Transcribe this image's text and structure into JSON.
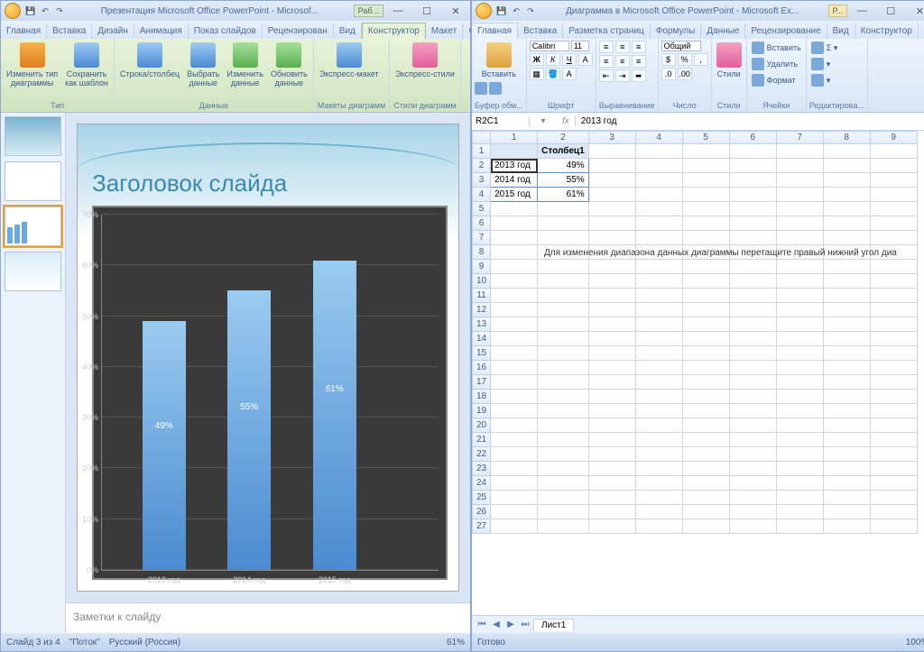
{
  "powerpoint": {
    "title": "Презентация Microsoft Office PowerPoint - Microsof...",
    "context_tab": "Раб...",
    "tabs": [
      "Главная",
      "Вставка",
      "Дизайн",
      "Анимация",
      "Показ слайдов",
      "Рецензирован",
      "Вид",
      "Конструктор",
      "Макет",
      "Формат"
    ],
    "active_tab_index": 7,
    "ribbon_groups": {
      "type": {
        "change_type": "Изменить тип\nдиаграммы",
        "save_template": "Сохранить\nкак шаблон",
        "label": "Тип"
      },
      "data": {
        "switch": "Строка/столбец",
        "select": "Выбрать\nданные",
        "edit": "Изменить\nданные",
        "refresh": "Обновить\nданные",
        "label": "Данные"
      },
      "layouts": {
        "express_layout": "Экспресс-макет",
        "label": "Макеты диаграмм"
      },
      "styles": {
        "express_styles": "Экспресс-стили",
        "label": "Стили диаграмм"
      }
    },
    "slide_title": "Заголовок слайда",
    "notes_placeholder": "Заметки к слайду",
    "status": {
      "slide": "Слайд 3 из 4",
      "theme": "\"Поток\"",
      "lang": "Русский (Россия)",
      "zoom": "61%"
    }
  },
  "excel": {
    "title": "Диаграмма в Microsoft Office PowerPoint - Microsoft Ex...",
    "context_tab": "Р...",
    "tabs": [
      "Главная",
      "Вставка",
      "Разметка страниц",
      "Формулы",
      "Данные",
      "Рецензирование",
      "Вид",
      "Конструктор"
    ],
    "ribbon": {
      "clipboard": {
        "paste": "Вставить",
        "label": "Буфер обм..."
      },
      "font": {
        "name": "Calibri",
        "size": "11",
        "label": "Шрифт"
      },
      "align": {
        "label": "Выравнивание"
      },
      "number": {
        "format": "Общий",
        "label": "Число"
      },
      "styles": {
        "btn": "Стили",
        "label": "Стили"
      },
      "cells": {
        "insert": "Вставить",
        "delete": "Удалить",
        "format": "Формат",
        "label": "Ячейки"
      },
      "editing": {
        "label": "Редактирова..."
      }
    },
    "namebox": "R2C1",
    "formula": "2013 год",
    "col_header": "Столбец1",
    "rows": [
      {
        "label": "2013 год",
        "val": "49%"
      },
      {
        "label": "2014 год",
        "val": "55%"
      },
      {
        "label": "2015 год",
        "val": "61%"
      }
    ],
    "hint": "Для изменения диапазона данных диаграммы перетащите правый нижний угол диа",
    "sheet_tab": "Лист1",
    "status": {
      "ready": "Готово",
      "zoom": "100%"
    }
  },
  "chart_data": {
    "type": "bar",
    "title": "Заголовок слайда",
    "categories": [
      "2013 год",
      "2014 год",
      "2015 год"
    ],
    "values": [
      49,
      55,
      61
    ],
    "ylabel": "",
    "ylim": [
      0,
      70
    ],
    "yticks": [
      "0%",
      "10%",
      "20%",
      "30%",
      "40%",
      "50%",
      "60%",
      "70%"
    ]
  }
}
